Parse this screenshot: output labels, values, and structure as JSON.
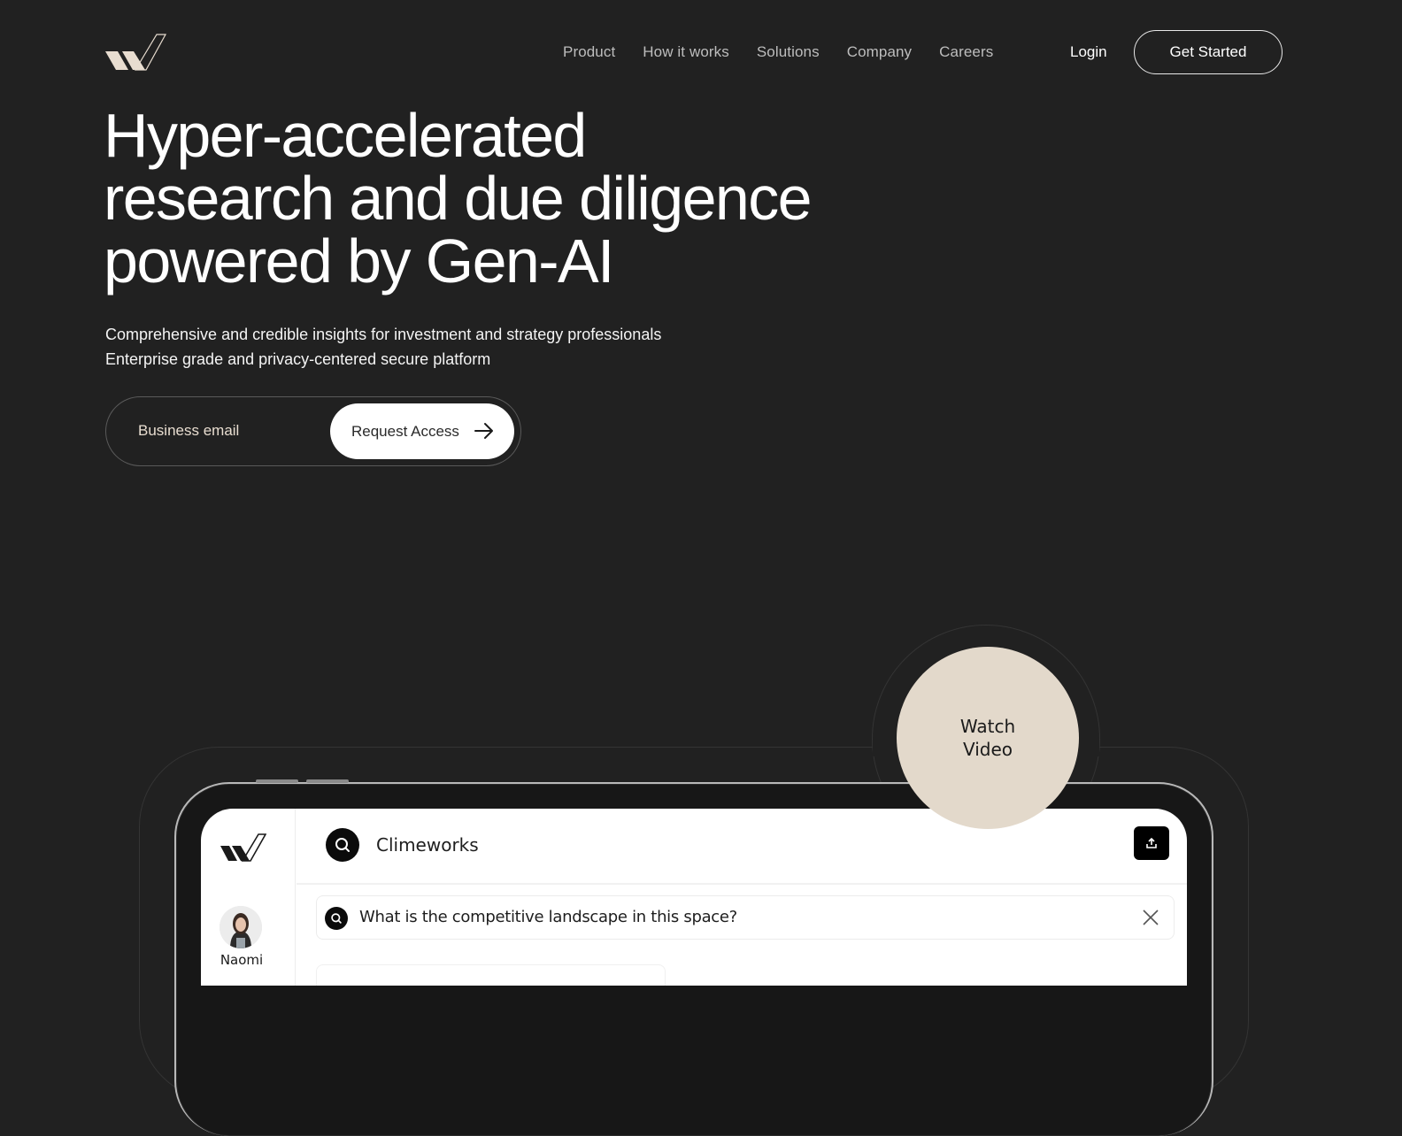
{
  "header": {
    "logo": "brand-w-logo",
    "nav": [
      "Product",
      "How it works",
      "Solutions",
      "Company",
      "Careers"
    ],
    "login_label": "Login",
    "cta_label": "Get Started"
  },
  "hero": {
    "title_lines": [
      "Hyper-accelerated",
      "research and due diligence",
      "powered by Gen-AI"
    ],
    "subtitle_lines": [
      "Comprehensive and credible insights for investment and strategy professionals",
      "Enterprise grade and privacy-centered secure platform"
    ],
    "email_placeholder": "Business email",
    "email_value": "",
    "request_label": "Request Access",
    "request_icon": "arrow-right-icon"
  },
  "video": {
    "line1": "Watch",
    "line2": "Video"
  },
  "app_preview": {
    "user_name": "Naomi",
    "company_query": "Climeworks",
    "question": "What is the competitive landscape in this space?",
    "icons": {
      "search": "search-icon",
      "share": "share-icon",
      "close": "close-icon"
    }
  },
  "colors": {
    "background": "#212121",
    "accent_beige": "#e3d9cb",
    "logo_beige": "#e8ddd0",
    "nav_text": "#bdbdbd"
  }
}
